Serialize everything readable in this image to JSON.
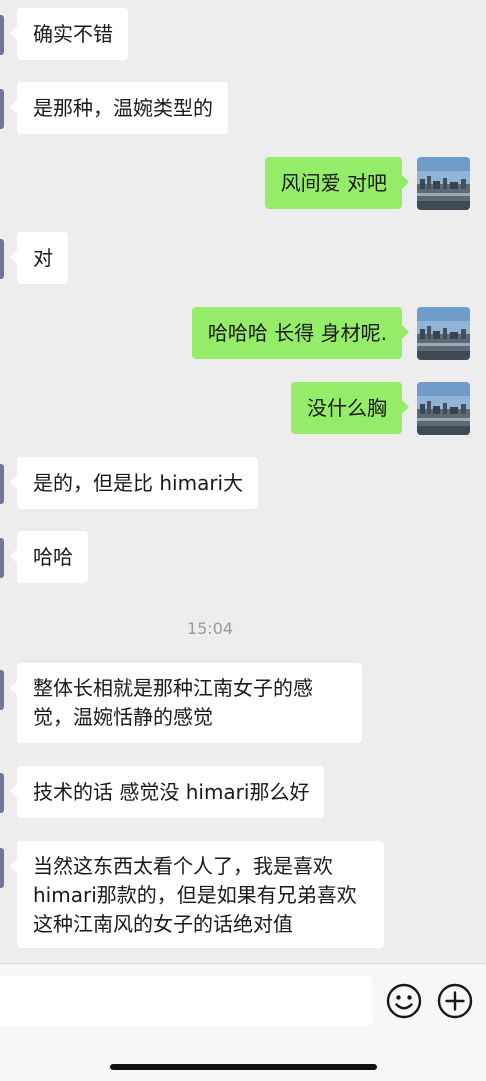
{
  "messages": [
    {
      "side": "in",
      "text": "确实不错"
    },
    {
      "side": "in",
      "text": "是那种，温婉类型的"
    },
    {
      "side": "out",
      "text": "风间爱 对吧"
    },
    {
      "side": "in",
      "text": "对"
    },
    {
      "side": "out",
      "text": "哈哈哈 长得 身材呢."
    },
    {
      "side": "out",
      "text": "没什么胸"
    },
    {
      "side": "in",
      "text": "是的，但是比 himari大"
    },
    {
      "side": "in",
      "text": "哈哈"
    },
    {
      "side": "in",
      "text": "整体长相就是那种江南女子的感觉，温婉恬静的感觉"
    },
    {
      "side": "in",
      "text": "技术的话 感觉没 himari那么好"
    },
    {
      "side": "in",
      "text": "当然这东西太看个人了，我是喜欢himari那款的，但是如果有兄弟喜欢这种江南风的女子的话绝对值"
    }
  ],
  "timestamp": "15:04",
  "input_bar": {
    "emoji_icon": "emoji-icon",
    "plus_icon": "plus-icon"
  },
  "colors": {
    "background": "#ededed",
    "outgoing_bubble": "#95ec69",
    "incoming_bubble": "#ffffff"
  }
}
